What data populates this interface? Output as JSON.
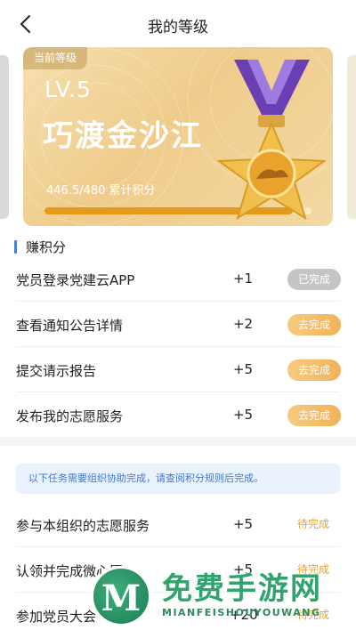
{
  "header": {
    "title": "我的等级"
  },
  "level_card": {
    "tag": "当前等级",
    "level": "LV.5",
    "name": "巧渡金沙江",
    "points_text": "446.5/480 累计积分",
    "progress": 0.93
  },
  "earn_section": {
    "title": "赚积分"
  },
  "tasks": [
    {
      "name": "党员登录党建云APP",
      "points": "+1",
      "action": "已完成",
      "state": "done"
    },
    {
      "name": "查看通知公告详情",
      "points": "+2",
      "action": "去完成",
      "state": "todo"
    },
    {
      "name": "提交请示报告",
      "points": "+5",
      "action": "去完成",
      "state": "todo"
    },
    {
      "name": "发布我的志愿服务",
      "points": "+5",
      "action": "去完成",
      "state": "todo"
    }
  ],
  "org_notice": "以下任务需要组织协助完成，请查阅积分规则后完成。",
  "org_tasks": [
    {
      "name": "参与本组织的志愿服务",
      "points": "+5",
      "status": "待完成"
    },
    {
      "name": "认领并完成微心愿",
      "points": "+5",
      "status": "待完成"
    },
    {
      "name": "参加党员大会",
      "points": "+20",
      "status": "待完成"
    }
  ],
  "watermark": {
    "logo_letter": "M",
    "title": "免费手游网",
    "subtitle": "MIANFEISHOUYOUWANG"
  },
  "colors": {
    "accent_blue": "#4a7fd6",
    "gold": "#e59a1b",
    "todo_button": "#f2b258",
    "done_button": "#c5c5c5"
  }
}
